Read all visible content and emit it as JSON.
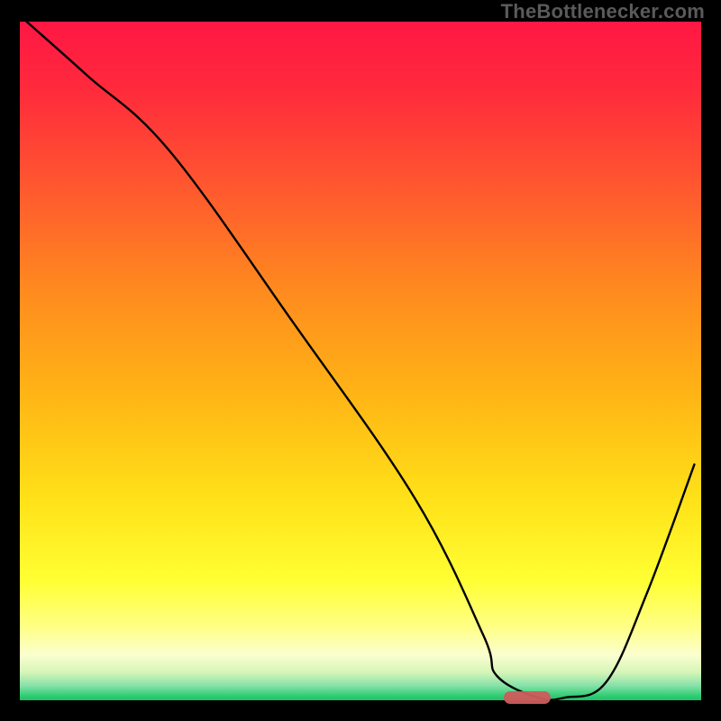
{
  "attribution": "TheBottlenecker.com",
  "chart_data": {
    "type": "line",
    "title": "",
    "xlabel": "",
    "ylabel": "",
    "xlim": [
      0,
      100
    ],
    "ylim": [
      0,
      100
    ],
    "gradient_bands": [
      {
        "stop": 0.0,
        "color": "#FF1744"
      },
      {
        "stop": 0.1,
        "color": "#FF2A3C"
      },
      {
        "stop": 0.25,
        "color": "#FF5A2E"
      },
      {
        "stop": 0.4,
        "color": "#FF8C1E"
      },
      {
        "stop": 0.55,
        "color": "#FFB515"
      },
      {
        "stop": 0.7,
        "color": "#FFE118"
      },
      {
        "stop": 0.82,
        "color": "#FFFF33"
      },
      {
        "stop": 0.89,
        "color": "#FFFF88"
      },
      {
        "stop": 0.93,
        "color": "#FAFFD0"
      },
      {
        "stop": 0.955,
        "color": "#D6F5B8"
      },
      {
        "stop": 0.975,
        "color": "#84E1A8"
      },
      {
        "stop": 0.99,
        "color": "#2ECC71"
      },
      {
        "stop": 1.0,
        "color": "#18B765"
      }
    ],
    "series": [
      {
        "name": "bottleneck-curve",
        "color": "#000000",
        "x": [
          1,
          10,
          22,
          40,
          58,
          68,
          70,
          76,
          80,
          86,
          92,
          99
        ],
        "y": [
          100,
          92,
          81,
          56,
          30,
          10,
          4,
          0.8,
          0.8,
          3,
          16,
          35
        ]
      }
    ],
    "marker": {
      "x_center": 74.5,
      "y": 0.8,
      "width_pct": 6.9
    }
  }
}
